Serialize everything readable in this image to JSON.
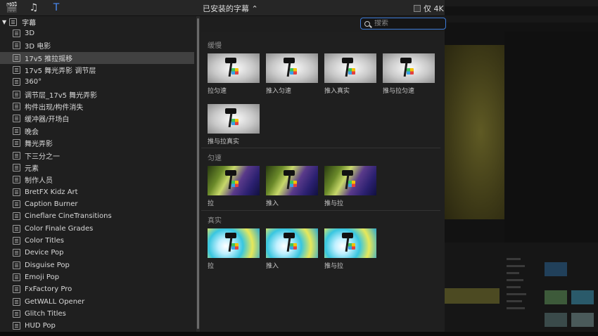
{
  "toolbar": {
    "icons": [
      "clapper-icon",
      "music-icon",
      "titles-icon"
    ],
    "browser_title": "已安装的字幕 ⌃",
    "only_4k_label": "仅 4K"
  },
  "sidebar": {
    "root_label": "字幕",
    "items": [
      {
        "label": "3D"
      },
      {
        "label": "3D 电影"
      },
      {
        "label": "17v5 推拉摇移",
        "selected": true
      },
      {
        "label": "17v5 舞光弄影 调节层"
      },
      {
        "label": "360°"
      },
      {
        "label": "调节层_17v5 舞光弄影"
      },
      {
        "label": "构件出现/构件消失"
      },
      {
        "label": "缓冲器/开场白"
      },
      {
        "label": "晚会"
      },
      {
        "label": "舞光弄影"
      },
      {
        "label": "下三分之一"
      },
      {
        "label": "元素"
      },
      {
        "label": "制作人员"
      },
      {
        "label": "BretFX Kidz Art"
      },
      {
        "label": "Caption Burner"
      },
      {
        "label": "Cineflare CineTransitions"
      },
      {
        "label": "Color Finale Grades"
      },
      {
        "label": "Color Titles"
      },
      {
        "label": "Device Pop"
      },
      {
        "label": "Disguise Pop"
      },
      {
        "label": "Emoji Pop"
      },
      {
        "label": "FxFactory Pro"
      },
      {
        "label": "GetWALL Opener"
      },
      {
        "label": "Glitch Titles"
      },
      {
        "label": "HUD Pop"
      }
    ]
  },
  "search": {
    "placeholder": "搜索",
    "value": ""
  },
  "sections": [
    {
      "label": "缓慢",
      "tiles": [
        {
          "label": "拉匀速"
        },
        {
          "label": "推入匀速"
        },
        {
          "label": "推入真实"
        },
        {
          "label": "推与拉匀速"
        },
        {
          "label": "推与拉真实"
        }
      ]
    },
    {
      "label": "匀速",
      "tiles": [
        {
          "label": "拉"
        },
        {
          "label": "推入"
        },
        {
          "label": "推与拉"
        }
      ]
    },
    {
      "label": "真实",
      "tiles": [
        {
          "label": "拉"
        },
        {
          "label": "推入"
        },
        {
          "label": "推与拉"
        }
      ]
    }
  ],
  "colors": {
    "accent": "#4b8cf5",
    "panel": "#1f1f1f",
    "selected_row": "#414141"
  }
}
